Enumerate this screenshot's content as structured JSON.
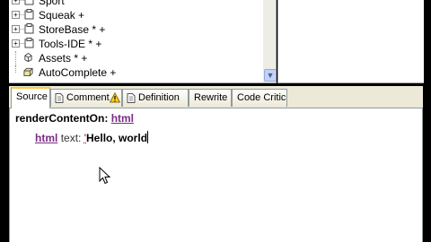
{
  "tree": {
    "items": [
      {
        "label": "Sport",
        "expandable": true
      },
      {
        "label": "Squeak +",
        "expandable": true
      },
      {
        "label": "StoreBase * +",
        "expandable": true
      },
      {
        "label": "Tools-IDE * +",
        "expandable": true
      },
      {
        "label": "Assets * +",
        "expandable": false
      },
      {
        "label": "AutoComplete +",
        "expandable": false
      }
    ]
  },
  "tabs": [
    {
      "label": "Source",
      "active": true
    },
    {
      "label": "Comment",
      "icon": "warning-icon"
    },
    {
      "label": "Definition",
      "icon": "doc-icon"
    },
    {
      "label": "Rewrite"
    },
    {
      "label": "Code Critic"
    }
  ],
  "editor": {
    "selector": "renderContentOn:",
    "arg": "html",
    "receiver": "html",
    "message": "text:",
    "string_open": "'",
    "string_body": "Hello, world"
  },
  "colors": {
    "accent_tab": "#ffc83c",
    "keyword": "#7b2a85",
    "chrome": "#ece9d8"
  }
}
